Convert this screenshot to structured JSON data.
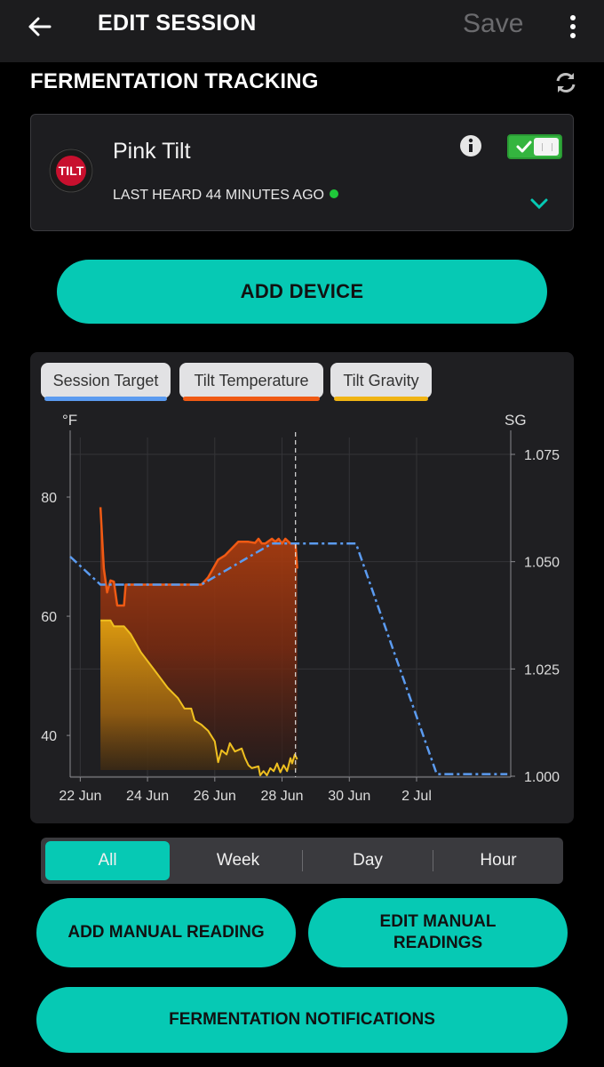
{
  "header": {
    "title": "EDIT SESSION",
    "save_label": "Save"
  },
  "section": {
    "title": "FERMENTATION TRACKING"
  },
  "device": {
    "name": "Pink Tilt",
    "logo_text": "TILT",
    "last_heard": "LAST HEARD 44 MINUTES AGO",
    "enabled": true,
    "status_color": "#1fc93a"
  },
  "buttons": {
    "add_device": "ADD DEVICE",
    "add_manual": "ADD MANUAL READING",
    "edit_manual": "EDIT MANUAL READINGS",
    "notifications": "FERMENTATION NOTIFICATIONS"
  },
  "legend": [
    {
      "label": "Session Target",
      "color": "#5b9bf0"
    },
    {
      "label": "Tilt Temperature",
      "color": "#f05a14"
    },
    {
      "label": "Tilt Gravity",
      "color": "#f0b414"
    }
  ],
  "range_tabs": {
    "items": [
      "All",
      "Week",
      "Day",
      "Hour"
    ],
    "active": "All"
  },
  "colors": {
    "accent": "#06c9b4",
    "target": "#5b9bf0",
    "temperature": "#f05a14",
    "gravity": "#f0b414"
  },
  "chart_data": {
    "type": "area",
    "y_left_unit": "°F",
    "y_right_unit": "SG",
    "x_ticks": [
      "22 Jun",
      "24 Jun",
      "26 Jun",
      "28 Jun",
      "30 Jun",
      "2 Jul"
    ],
    "y_left_ticks": [
      "40",
      "60",
      "80"
    ],
    "y_right_ticks": [
      "1.000",
      "1.025",
      "1.050",
      "1.075"
    ],
    "ylim_left": [
      33,
      90
    ],
    "ylim_right": [
      1.0,
      1.075
    ],
    "x_range_days": [
      "21.7 Jun",
      "3.8 Jul"
    ],
    "current_time": "28.4 Jun",
    "grid": true,
    "series": [
      {
        "name": "Session Target",
        "axis": "left",
        "style": "dash-dot",
        "points": [
          [
            21.7,
            70
          ],
          [
            22.6,
            65.3
          ],
          [
            24.8,
            65.3
          ],
          [
            25.6,
            65.3
          ],
          [
            27.7,
            72.2
          ],
          [
            28.0,
            72.2
          ],
          [
            30.2,
            72.2
          ],
          [
            32.6,
            33.5
          ],
          [
            34.7,
            33.5
          ]
        ]
      },
      {
        "name": "Tilt Temperature",
        "axis": "left",
        "style": "area",
        "points": [
          [
            22.6,
            78.3
          ],
          [
            22.7,
            68
          ],
          [
            22.8,
            64
          ],
          [
            22.9,
            66
          ],
          [
            23.0,
            65.8
          ],
          [
            23.1,
            61.8
          ],
          [
            23.3,
            61.8
          ],
          [
            23.35,
            65.3
          ],
          [
            25.6,
            65.3
          ],
          [
            25.8,
            66.5
          ],
          [
            26.1,
            69.5
          ],
          [
            26.3,
            70.2
          ],
          [
            26.7,
            72.5
          ],
          [
            27.0,
            72.5
          ],
          [
            27.2,
            72.3
          ],
          [
            27.3,
            73
          ],
          [
            27.4,
            72.2
          ],
          [
            27.5,
            72.2
          ],
          [
            27.7,
            73
          ],
          [
            27.8,
            72.5
          ],
          [
            27.9,
            73
          ],
          [
            28.0,
            72.2
          ],
          [
            28.1,
            73
          ],
          [
            28.25,
            72.2
          ],
          [
            28.4,
            72.2
          ],
          [
            28.45,
            68
          ]
        ]
      },
      {
        "name": "Tilt Gravity",
        "axis": "left",
        "style": "area",
        "points": [
          [
            22.6,
            59.3
          ],
          [
            22.9,
            59.3
          ],
          [
            23.0,
            58.3
          ],
          [
            23.3,
            58.3
          ],
          [
            23.5,
            57
          ],
          [
            23.8,
            54
          ],
          [
            24.2,
            51
          ],
          [
            24.6,
            48
          ],
          [
            24.9,
            46.3
          ],
          [
            25.1,
            44.5
          ],
          [
            25.3,
            44.5
          ],
          [
            25.4,
            42.5
          ],
          [
            25.6,
            41.8
          ],
          [
            25.8,
            40.8
          ],
          [
            26.0,
            39
          ],
          [
            26.1,
            35.5
          ],
          [
            26.2,
            37.5
          ],
          [
            26.35,
            36.8
          ],
          [
            26.45,
            38.7
          ],
          [
            26.6,
            37.3
          ],
          [
            26.8,
            37.8
          ],
          [
            26.9,
            36.2
          ],
          [
            27.0,
            35
          ],
          [
            27.1,
            34.5
          ],
          [
            27.3,
            34.8
          ],
          [
            27.35,
            33.3
          ],
          [
            27.45,
            34
          ],
          [
            27.55,
            33.3
          ],
          [
            27.65,
            34.5
          ],
          [
            27.75,
            34
          ],
          [
            27.85,
            35.3
          ],
          [
            27.95,
            33.8
          ],
          [
            28.05,
            35
          ],
          [
            28.15,
            34
          ],
          [
            28.25,
            36.2
          ],
          [
            28.3,
            35.3
          ],
          [
            28.38,
            36.8
          ],
          [
            28.45,
            36
          ]
        ]
      }
    ]
  }
}
